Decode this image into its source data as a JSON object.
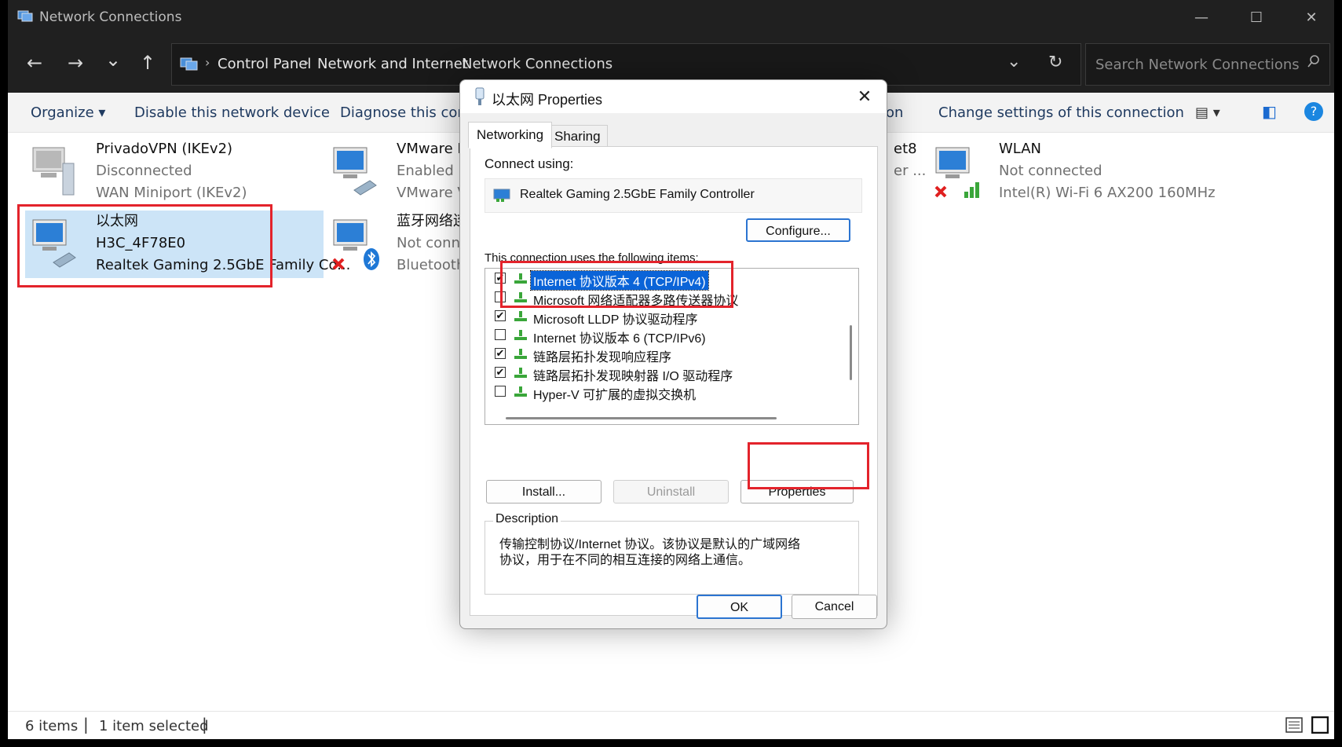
{
  "window": {
    "title": "Network Connections",
    "controls": {
      "minimize": "—",
      "maximize": "☐",
      "close": "✕"
    }
  },
  "nav": {
    "back_icon": "←",
    "forward_icon": "→",
    "recent_icon": "⌄",
    "up_icon": "↑",
    "breadcrumbs": [
      "Control Panel",
      "Network and Internet",
      "Network Connections"
    ],
    "separator": "›",
    "dropdown_icon": "⌄",
    "refresh_icon": "↻",
    "search_placeholder": "Search Network Connections"
  },
  "commands": {
    "organize": "Organize ▾",
    "disable": "Disable this network device",
    "diagnose": "Diagnose this conn",
    "rename_tail": "on",
    "change_settings": "Change settings of this connection",
    "view_icon": "▤ ▾",
    "pane_icon": "◧",
    "help_icon": "?"
  },
  "connections": [
    {
      "name": "PrivadoVPN (IKEv2)",
      "status": "Disconnected",
      "device": "WAN Miniport (IKEv2)"
    },
    {
      "name": "VMware Ne",
      "status": "Enabled",
      "device": "VMware Vi"
    },
    {
      "name": "et8",
      "status": "",
      "device": "er ..."
    },
    {
      "name": "WLAN",
      "status": "Not connected",
      "device": "Intel(R) Wi-Fi 6 AX200 160MHz"
    },
    {
      "name": "以太网",
      "status": "H3C_4F78E0",
      "device": "Realtek Gaming 2.5GbE Family Co..."
    },
    {
      "name": "蓝牙网络连",
      "status": "Not conne",
      "device": "Bluetooth D"
    }
  ],
  "status": {
    "items": "6 items",
    "selected": "1 item selected"
  },
  "dialog": {
    "title": "以太网 Properties",
    "close": "✕",
    "tabs": [
      "Networking",
      "Sharing"
    ],
    "connect_using_label": "Connect using:",
    "adapter": "Realtek Gaming 2.5GbE Family Controller",
    "configure": "Configure...",
    "items_label": "This connection uses the following items:",
    "items": [
      {
        "label": "Internet 协议版本 4 (TCP/IPv4)",
        "checked": "✔"
      },
      {
        "label": "Microsoft 网络适配器多路传送器协议",
        "checked": ""
      },
      {
        "label": "Microsoft LLDP 协议驱动程序",
        "checked": "✔"
      },
      {
        "label": "Internet 协议版本 6 (TCP/IPv6)",
        "checked": ""
      },
      {
        "label": "链路层拓扑发现响应程序",
        "checked": "✔"
      },
      {
        "label": "链路层拓扑发现映射器 I/O 驱动程序",
        "checked": "✔"
      },
      {
        "label": "Hyper-V 可扩展的虚拟交换机",
        "checked": ""
      }
    ],
    "install": "Install...",
    "uninstall": "Uninstall",
    "properties": "Properties",
    "description_label": "Description",
    "description_line1": "传输控制协议/Internet 协议。该协议是默认的广域网络",
    "description_line2": "协议，用于在不同的相互连接的网络上通信。",
    "ok": "OK",
    "cancel": "Cancel"
  },
  "colors": {
    "highlight": "#e3232b",
    "selection": "#cce4f7",
    "accent": "#0a64d8"
  }
}
